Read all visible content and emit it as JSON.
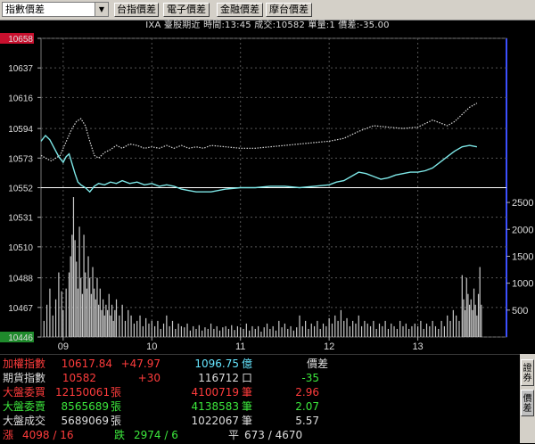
{
  "toolbar": {
    "selector_value": "指數價差",
    "buttons": [
      "台指價差",
      "電子價差",
      "金融價差",
      "摩台價差"
    ]
  },
  "info_line": "IXA  臺股期近 時間:13:45 成交:10582 單量:1  價差:-35.00",
  "chart_data": {
    "type": "line",
    "title": "",
    "y_ticks_left": [
      10658,
      10637,
      10616,
      10594,
      10573,
      10552,
      10531,
      10510,
      10488,
      10467,
      10446
    ],
    "y_highlight_top": "10658",
    "y_highlight_bottom": "10446",
    "ylim": [
      10446,
      10658
    ],
    "y_ticks_right_volume": [
      2500,
      2000,
      1500,
      1000,
      500
    ],
    "volume_ylim": [
      0,
      2700
    ],
    "x_tick_labels": [
      "09",
      "10",
      "11",
      "12",
      "13"
    ],
    "x_tick_minutes": [
      0,
      60,
      120,
      180,
      240
    ],
    "x_range_minutes": [
      -15,
      300
    ],
    "reference_line": 10552,
    "series": [
      {
        "color": "#d8d8d8",
        "style": "dotted",
        "points": [
          [
            -15,
            10575
          ],
          [
            -12,
            10573
          ],
          [
            -8,
            10571
          ],
          [
            -5,
            10573
          ],
          [
            -2,
            10575
          ],
          [
            0,
            10580
          ],
          [
            3,
            10587
          ],
          [
            6,
            10594
          ],
          [
            9,
            10599
          ],
          [
            12,
            10601
          ],
          [
            15,
            10596
          ],
          [
            18,
            10585
          ],
          [
            21,
            10575
          ],
          [
            24,
            10573
          ],
          [
            28,
            10577
          ],
          [
            32,
            10579
          ],
          [
            36,
            10582
          ],
          [
            40,
            10580
          ],
          [
            45,
            10583
          ],
          [
            50,
            10582
          ],
          [
            55,
            10580
          ],
          [
            60,
            10581
          ],
          [
            65,
            10580
          ],
          [
            70,
            10582
          ],
          [
            75,
            10580
          ],
          [
            80,
            10582
          ],
          [
            85,
            10580
          ],
          [
            90,
            10581
          ],
          [
            95,
            10580
          ],
          [
            100,
            10582
          ],
          [
            110,
            10581
          ],
          [
            120,
            10580
          ],
          [
            130,
            10580
          ],
          [
            140,
            10581
          ],
          [
            150,
            10582
          ],
          [
            160,
            10583
          ],
          [
            170,
            10584
          ],
          [
            180,
            10585
          ],
          [
            190,
            10587
          ],
          [
            200,
            10592
          ],
          [
            210,
            10596
          ],
          [
            220,
            10595
          ],
          [
            230,
            10594
          ],
          [
            240,
            10595
          ],
          [
            250,
            10600
          ],
          [
            255,
            10598
          ],
          [
            260,
            10596
          ],
          [
            265,
            10599
          ],
          [
            270,
            10604
          ],
          [
            275,
            10609
          ],
          [
            280,
            10612
          ]
        ]
      },
      {
        "color": "#7ee8e8",
        "style": "solid",
        "points": [
          [
            -15,
            10585
          ],
          [
            -12,
            10589
          ],
          [
            -9,
            10586
          ],
          [
            -6,
            10580
          ],
          [
            -3,
            10574
          ],
          [
            0,
            10570
          ],
          [
            2,
            10574
          ],
          [
            4,
            10576
          ],
          [
            6,
            10569
          ],
          [
            8,
            10562
          ],
          [
            10,
            10556
          ],
          [
            12,
            10554
          ],
          [
            15,
            10552
          ],
          [
            18,
            10549
          ],
          [
            21,
            10553
          ],
          [
            24,
            10555
          ],
          [
            28,
            10554
          ],
          [
            32,
            10556
          ],
          [
            36,
            10555
          ],
          [
            40,
            10557
          ],
          [
            45,
            10555
          ],
          [
            50,
            10556
          ],
          [
            55,
            10554
          ],
          [
            60,
            10555
          ],
          [
            65,
            10553
          ],
          [
            70,
            10554
          ],
          [
            75,
            10553
          ],
          [
            80,
            10551
          ],
          [
            85,
            10550
          ],
          [
            90,
            10549
          ],
          [
            95,
            10549
          ],
          [
            100,
            10549
          ],
          [
            110,
            10551
          ],
          [
            120,
            10552
          ],
          [
            130,
            10552
          ],
          [
            140,
            10553
          ],
          [
            150,
            10553
          ],
          [
            160,
            10552
          ],
          [
            170,
            10553
          ],
          [
            180,
            10554
          ],
          [
            185,
            10556
          ],
          [
            190,
            10557
          ],
          [
            195,
            10560
          ],
          [
            200,
            10563
          ],
          [
            205,
            10562
          ],
          [
            210,
            10560
          ],
          [
            215,
            10558
          ],
          [
            220,
            10559
          ],
          [
            225,
            10561
          ],
          [
            230,
            10562
          ],
          [
            235,
            10563
          ],
          [
            240,
            10563
          ],
          [
            245,
            10564
          ],
          [
            250,
            10566
          ],
          [
            255,
            10570
          ],
          [
            260,
            10574
          ],
          [
            265,
            10578
          ],
          [
            270,
            10581
          ],
          [
            275,
            10582
          ],
          [
            280,
            10581
          ]
        ]
      }
    ],
    "volume": [
      [
        -13,
        300
      ],
      [
        -11,
        600
      ],
      [
        -9,
        900
      ],
      [
        -7,
        400
      ],
      [
        -5,
        700
      ],
      [
        -3,
        1200
      ],
      [
        -1,
        850
      ],
      [
        0,
        500
      ],
      [
        2,
        900
      ],
      [
        4,
        1200
      ],
      [
        5,
        1500
      ],
      [
        6,
        1900
      ],
      [
        7,
        2600
      ],
      [
        8,
        1800
      ],
      [
        9,
        1400
      ],
      [
        10,
        900
      ],
      [
        11,
        2050
      ],
      [
        12,
        1100
      ],
      [
        13,
        800
      ],
      [
        14,
        1900
      ],
      [
        15,
        1200
      ],
      [
        16,
        900
      ],
      [
        17,
        1500
      ],
      [
        18,
        1100
      ],
      [
        19,
        800
      ],
      [
        20,
        1300
      ],
      [
        21,
        900
      ],
      [
        22,
        700
      ],
      [
        23,
        1100
      ],
      [
        24,
        600
      ],
      [
        25,
        900
      ],
      [
        26,
        500
      ],
      [
        27,
        700
      ],
      [
        28,
        400
      ],
      [
        29,
        600
      ],
      [
        30,
        500
      ],
      [
        31,
        800
      ],
      [
        32,
        400
      ],
      [
        33,
        600
      ],
      [
        34,
        300
      ],
      [
        35,
        500
      ],
      [
        36,
        700
      ],
      [
        38,
        400
      ],
      [
        40,
        600
      ],
      [
        42,
        300
      ],
      [
        44,
        500
      ],
      [
        46,
        400
      ],
      [
        48,
        250
      ],
      [
        50,
        300
      ],
      [
        52,
        400
      ],
      [
        54,
        200
      ],
      [
        56,
        350
      ],
      [
        58,
        250
      ],
      [
        60,
        300
      ],
      [
        62,
        200
      ],
      [
        64,
        300
      ],
      [
        66,
        150
      ],
      [
        68,
        250
      ],
      [
        70,
        400
      ],
      [
        72,
        200
      ],
      [
        74,
        300
      ],
      [
        76,
        150
      ],
      [
        78,
        250
      ],
      [
        80,
        200
      ],
      [
        82,
        180
      ],
      [
        84,
        250
      ],
      [
        86,
        120
      ],
      [
        88,
        200
      ],
      [
        90,
        150
      ],
      [
        92,
        220
      ],
      [
        94,
        120
      ],
      [
        96,
        180
      ],
      [
        98,
        150
      ],
      [
        100,
        250
      ],
      [
        102,
        150
      ],
      [
        104,
        200
      ],
      [
        106,
        120
      ],
      [
        108,
        180
      ],
      [
        110,
        200
      ],
      [
        112,
        150
      ],
      [
        114,
        220
      ],
      [
        116,
        130
      ],
      [
        118,
        200
      ],
      [
        120,
        180
      ],
      [
        122,
        150
      ],
      [
        124,
        250
      ],
      [
        126,
        120
      ],
      [
        128,
        200
      ],
      [
        130,
        150
      ],
      [
        132,
        200
      ],
      [
        134,
        100
      ],
      [
        136,
        180
      ],
      [
        138,
        250
      ],
      [
        140,
        150
      ],
      [
        142,
        200
      ],
      [
        144,
        120
      ],
      [
        146,
        300
      ],
      [
        148,
        180
      ],
      [
        150,
        250
      ],
      [
        152,
        150
      ],
      [
        154,
        200
      ],
      [
        156,
        120
      ],
      [
        158,
        180
      ],
      [
        160,
        400
      ],
      [
        162,
        200
      ],
      [
        164,
        300
      ],
      [
        166,
        150
      ],
      [
        168,
        250
      ],
      [
        170,
        200
      ],
      [
        172,
        300
      ],
      [
        174,
        150
      ],
      [
        176,
        250
      ],
      [
        178,
        200
      ],
      [
        180,
        350
      ],
      [
        182,
        250
      ],
      [
        184,
        400
      ],
      [
        186,
        300
      ],
      [
        188,
        500
      ],
      [
        190,
        300
      ],
      [
        192,
        350
      ],
      [
        194,
        200
      ],
      [
        196,
        300
      ],
      [
        198,
        250
      ],
      [
        200,
        400
      ],
      [
        202,
        200
      ],
      [
        204,
        300
      ],
      [
        206,
        250
      ],
      [
        208,
        200
      ],
      [
        210,
        300
      ],
      [
        212,
        150
      ],
      [
        214,
        250
      ],
      [
        216,
        200
      ],
      [
        218,
        300
      ],
      [
        220,
        150
      ],
      [
        222,
        250
      ],
      [
        224,
        200
      ],
      [
        226,
        150
      ],
      [
        228,
        300
      ],
      [
        230,
        200
      ],
      [
        232,
        250
      ],
      [
        234,
        150
      ],
      [
        236,
        200
      ],
      [
        238,
        250
      ],
      [
        240,
        200
      ],
      [
        242,
        300
      ],
      [
        244,
        150
      ],
      [
        246,
        250
      ],
      [
        248,
        200
      ],
      [
        250,
        300
      ],
      [
        252,
        200
      ],
      [
        254,
        150
      ],
      [
        256,
        300
      ],
      [
        258,
        200
      ],
      [
        260,
        400
      ],
      [
        262,
        300
      ],
      [
        264,
        500
      ],
      [
        266,
        400
      ],
      [
        268,
        300
      ],
      [
        270,
        1150
      ],
      [
        271,
        700
      ],
      [
        272,
        500
      ],
      [
        273,
        1100
      ],
      [
        274,
        800
      ],
      [
        275,
        600
      ],
      [
        276,
        700
      ],
      [
        277,
        500
      ],
      [
        278,
        900
      ],
      [
        279,
        600
      ],
      [
        280,
        400
      ],
      [
        281,
        800
      ],
      [
        282,
        1300
      ],
      [
        283,
        600
      ]
    ]
  },
  "panel": {
    "rows": [
      {
        "label": "加權指數",
        "v1": "10617.84",
        "v2": "+47.97",
        "v3": "1096.75",
        "u3": "億",
        "v4": "價差"
      },
      {
        "label": "期貨指數",
        "v1": "10582",
        "v2": "+30",
        "v3": "116712",
        "u3": "口",
        "v4": "-35"
      },
      {
        "label": "大盤委買",
        "v1": "12150061",
        "u1": "張",
        "v3": "4100719",
        "u3": "筆",
        "v4": "2.96"
      },
      {
        "label": "大盤委賣",
        "v1": "8565689",
        "u1": "張",
        "v3": "4138583",
        "u3": "筆",
        "v4": "2.07"
      },
      {
        "label": "大盤成交",
        "v1": "5689069",
        "u1": "張",
        "v3": "1022067",
        "u3": "筆",
        "v4": "5.57"
      }
    ],
    "breadth": {
      "up_label": "漲",
      "up_value": "4098 / 16",
      "down_label": "跌",
      "down_value": "2974 / 6",
      "flat_label": "平",
      "flat_value": "673 / 4670"
    }
  },
  "side_tabs": [
    "證券",
    "價差"
  ],
  "colors": {
    "white_series": "#d8d8d8",
    "cyan_series": "#7ee8e8",
    "volume_bars": "#c8c8c8",
    "red": "#ff3c3c",
    "green": "#3ce83c",
    "cyan": "#66e6ff",
    "axis_highlight": "#c8102e"
  }
}
